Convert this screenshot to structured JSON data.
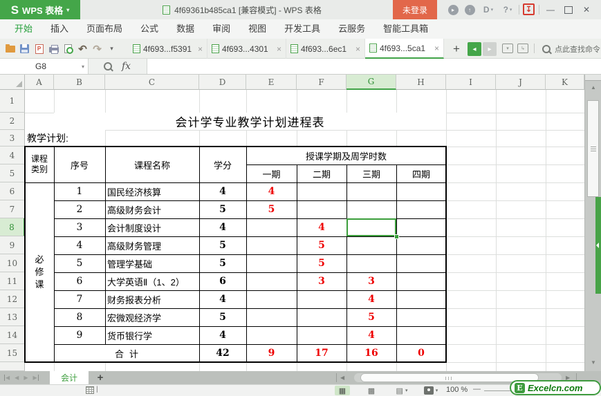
{
  "window": {
    "logo_s": "S",
    "logo_text": "WPS 表格",
    "title": "4f69361b485ca1 [兼容模式] - WPS 表格",
    "login_label": "未登录"
  },
  "icons": {
    "chevron_down": "▾",
    "close": "✕",
    "minimize": "—",
    "help": "?",
    "skin": "D",
    "download": "↧",
    "undo": "↶",
    "redo": "↷",
    "prev": "◂",
    "next": "▸",
    "plus": "+",
    "up": "▲",
    "down": "▼",
    "left": "◀",
    "right": "▶",
    "grid_view": "▦",
    "page_break_view": "▩",
    "page_layout_view": "▤",
    "tab_close": "×",
    "cursor": "|"
  },
  "menu": {
    "items": [
      {
        "label": "开始",
        "active": true
      },
      {
        "label": "插入",
        "active": false
      },
      {
        "label": "页面布局",
        "active": false
      },
      {
        "label": "公式",
        "active": false
      },
      {
        "label": "数据",
        "active": false
      },
      {
        "label": "审阅",
        "active": false
      },
      {
        "label": "视图",
        "active": false
      },
      {
        "label": "开发工具",
        "active": false
      },
      {
        "label": "云服务",
        "active": false
      },
      {
        "label": "智能工具箱",
        "active": false
      }
    ]
  },
  "doc_tabs": [
    {
      "label": "4f693...f5391",
      "active": false
    },
    {
      "label": "4f693...4301",
      "active": false
    },
    {
      "label": "4f693...6ec1",
      "active": false
    },
    {
      "label": "4f693...5ca1",
      "active": true
    }
  ],
  "toolbar": {
    "find_hint": "点此查找命令"
  },
  "formula_bar": {
    "name_box": "G8",
    "fx_label": "fx",
    "formula_value": ""
  },
  "sheet": {
    "columns": [
      "A",
      "B",
      "C",
      "D",
      "E",
      "F",
      "G",
      "H",
      "I",
      "J",
      "K"
    ],
    "row_numbers": [
      "1",
      "2",
      "3",
      "4",
      "5",
      "6",
      "7",
      "8",
      "9",
      "10",
      "11",
      "12",
      "13",
      "14",
      "15"
    ],
    "selected_column": "G",
    "selected_row": "8",
    "active_cell": "G8",
    "cells": [
      {
        "r": 2,
        "c": "B",
        "cs": 7,
        "text": "会计学专业教学计划进程表",
        "cls": "title"
      },
      {
        "r": 3,
        "c": "A",
        "cs": 2,
        "text": "教学计划:",
        "cls": "label"
      },
      {
        "r": 4,
        "c": "A",
        "rs": 2,
        "text": "课程类别",
        "cls": "th w2"
      },
      {
        "r": 4,
        "c": "B",
        "rs": 2,
        "text": "序号",
        "cls": "th"
      },
      {
        "r": 4,
        "c": "C",
        "rs": 2,
        "text": "课程名称",
        "cls": "th"
      },
      {
        "r": 4,
        "c": "D",
        "rs": 2,
        "text": "学分",
        "cls": "th"
      },
      {
        "r": 4,
        "c": "E",
        "cs": 4,
        "text": "授课学期及周学时数",
        "cls": "th"
      },
      {
        "r": 5,
        "c": "E",
        "text": "一期",
        "cls": "th"
      },
      {
        "r": 5,
        "c": "F",
        "text": "二期",
        "cls": "th"
      },
      {
        "r": 5,
        "c": "G",
        "text": "三期",
        "cls": "th"
      },
      {
        "r": 5,
        "c": "H",
        "text": "四期",
        "cls": "th"
      },
      {
        "r": 6,
        "c": "A",
        "rs": 10,
        "text": "必修课",
        "cls": "vert"
      },
      {
        "r": 6,
        "c": "B",
        "text": "1",
        "cls": "num"
      },
      {
        "r": 6,
        "c": "C",
        "text": "国民经济核算",
        "cls": "course"
      },
      {
        "r": 6,
        "c": "D",
        "text": "4",
        "cls": "credit"
      },
      {
        "r": 6,
        "c": "E",
        "text": "4",
        "cls": "red"
      },
      {
        "r": 7,
        "c": "B",
        "text": "2",
        "cls": "num"
      },
      {
        "r": 7,
        "c": "C",
        "text": "高级财务会计",
        "cls": "course"
      },
      {
        "r": 7,
        "c": "D",
        "text": "5",
        "cls": "credit"
      },
      {
        "r": 7,
        "c": "E",
        "text": "5",
        "cls": "red"
      },
      {
        "r": 8,
        "c": "B",
        "text": "3",
        "cls": "num"
      },
      {
        "r": 8,
        "c": "C",
        "text": "会计制度设计",
        "cls": "course"
      },
      {
        "r": 8,
        "c": "D",
        "text": "4",
        "cls": "credit"
      },
      {
        "r": 8,
        "c": "F",
        "text": "4",
        "cls": "red"
      },
      {
        "r": 9,
        "c": "B",
        "text": "4",
        "cls": "num"
      },
      {
        "r": 9,
        "c": "C",
        "text": "高级财务管理",
        "cls": "course"
      },
      {
        "r": 9,
        "c": "D",
        "text": "5",
        "cls": "credit"
      },
      {
        "r": 9,
        "c": "F",
        "text": "5",
        "cls": "red"
      },
      {
        "r": 10,
        "c": "B",
        "text": "5",
        "cls": "num"
      },
      {
        "r": 10,
        "c": "C",
        "text": "管理学基础",
        "cls": "course"
      },
      {
        "r": 10,
        "c": "D",
        "text": "5",
        "cls": "credit"
      },
      {
        "r": 10,
        "c": "F",
        "text": "5",
        "cls": "red"
      },
      {
        "r": 11,
        "c": "B",
        "text": "6",
        "cls": "num"
      },
      {
        "r": 11,
        "c": "C",
        "text": "大学英语Ⅱ（1、2）",
        "cls": "course"
      },
      {
        "r": 11,
        "c": "D",
        "text": "6",
        "cls": "credit"
      },
      {
        "r": 11,
        "c": "F",
        "text": "3",
        "cls": "red"
      },
      {
        "r": 11,
        "c": "G",
        "text": "3",
        "cls": "red"
      },
      {
        "r": 12,
        "c": "B",
        "text": "7",
        "cls": "num"
      },
      {
        "r": 12,
        "c": "C",
        "text": "财务报表分析",
        "cls": "course"
      },
      {
        "r": 12,
        "c": "D",
        "text": "4",
        "cls": "credit"
      },
      {
        "r": 12,
        "c": "G",
        "text": "4",
        "cls": "red"
      },
      {
        "r": 13,
        "c": "B",
        "text": "8",
        "cls": "num"
      },
      {
        "r": 13,
        "c": "C",
        "text": "宏微观经济学",
        "cls": "course"
      },
      {
        "r": 13,
        "c": "D",
        "text": "5",
        "cls": "credit"
      },
      {
        "r": 13,
        "c": "G",
        "text": "5",
        "cls": "red"
      },
      {
        "r": 14,
        "c": "B",
        "text": "9",
        "cls": "num"
      },
      {
        "r": 14,
        "c": "C",
        "text": "货币银行学",
        "cls": "course"
      },
      {
        "r": 14,
        "c": "D",
        "text": "4",
        "cls": "credit"
      },
      {
        "r": 14,
        "c": "G",
        "text": "4",
        "cls": "red"
      },
      {
        "r": 15,
        "c": "B",
        "cs": 2,
        "text": "合计",
        "cls": "th sum"
      },
      {
        "r": 15,
        "c": "D",
        "text": "42",
        "cls": "credit"
      },
      {
        "r": 15,
        "c": "E",
        "text": "9",
        "cls": "red"
      },
      {
        "r": 15,
        "c": "F",
        "text": "17",
        "cls": "red"
      },
      {
        "r": 15,
        "c": "G",
        "text": "16",
        "cls": "red"
      },
      {
        "r": 15,
        "c": "H",
        "text": "0",
        "cls": "red"
      }
    ]
  },
  "sheet_tab_bar": {
    "tabs": [
      {
        "label": "会计",
        "active": true
      }
    ]
  },
  "status_bar": {
    "zoom_label": "100 %"
  },
  "watermark": {
    "badge": "E",
    "text": "Excelcn.com"
  },
  "colors": {
    "accent_green": "#44a649",
    "selection_green": "#3b9e3b",
    "login_orange": "#e2674a",
    "cell_red": "#ee0000",
    "header_selected_bg": "#d8ecd3"
  }
}
